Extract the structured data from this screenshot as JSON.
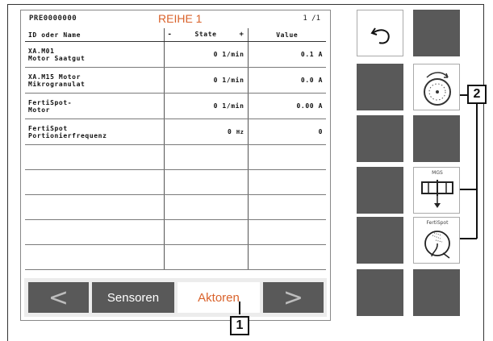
{
  "header": {
    "id": "PRE0000000",
    "title": "REIHE 1",
    "page": "1 /1"
  },
  "table": {
    "columns": {
      "name": "ID oder Name",
      "state_minus": "-",
      "state": "State",
      "state_plus": "+",
      "value": "Value"
    },
    "rows": [
      {
        "line1": "XA.M01",
        "line2": "Motor Saatgut",
        "state": "0 1/min",
        "value": "0.1 A"
      },
      {
        "line1": "XA.M15 Motor",
        "line2": "Mikrogranulat",
        "state": "0 1/min",
        "value": "0.0 A"
      },
      {
        "line1": "FertiSpot-",
        "line2": "Motor",
        "state": "0 1/min",
        "value": "0.00 A"
      },
      {
        "line1": "FertiSpot",
        "line2": "Portionierfrequenz",
        "state_num": "0",
        "state_unit": "Hz",
        "value": "0"
      }
    ]
  },
  "bottombar": {
    "prev": "<",
    "sensoren": "Sensoren",
    "aktoren": "Aktoren",
    "next": ">"
  },
  "rightpanel": {
    "mgs_label": "MGS",
    "fertispot_label": "FertiSpot"
  },
  "callouts": {
    "one": "1",
    "two": "2"
  },
  "colors": {
    "accent": "#d9622b",
    "button_dark": "#595959"
  },
  "icons": [
    "back-arrow-icon",
    "seed-disc-rotation-icon",
    "mgs-metering-icon",
    "fertispot-icon"
  ]
}
